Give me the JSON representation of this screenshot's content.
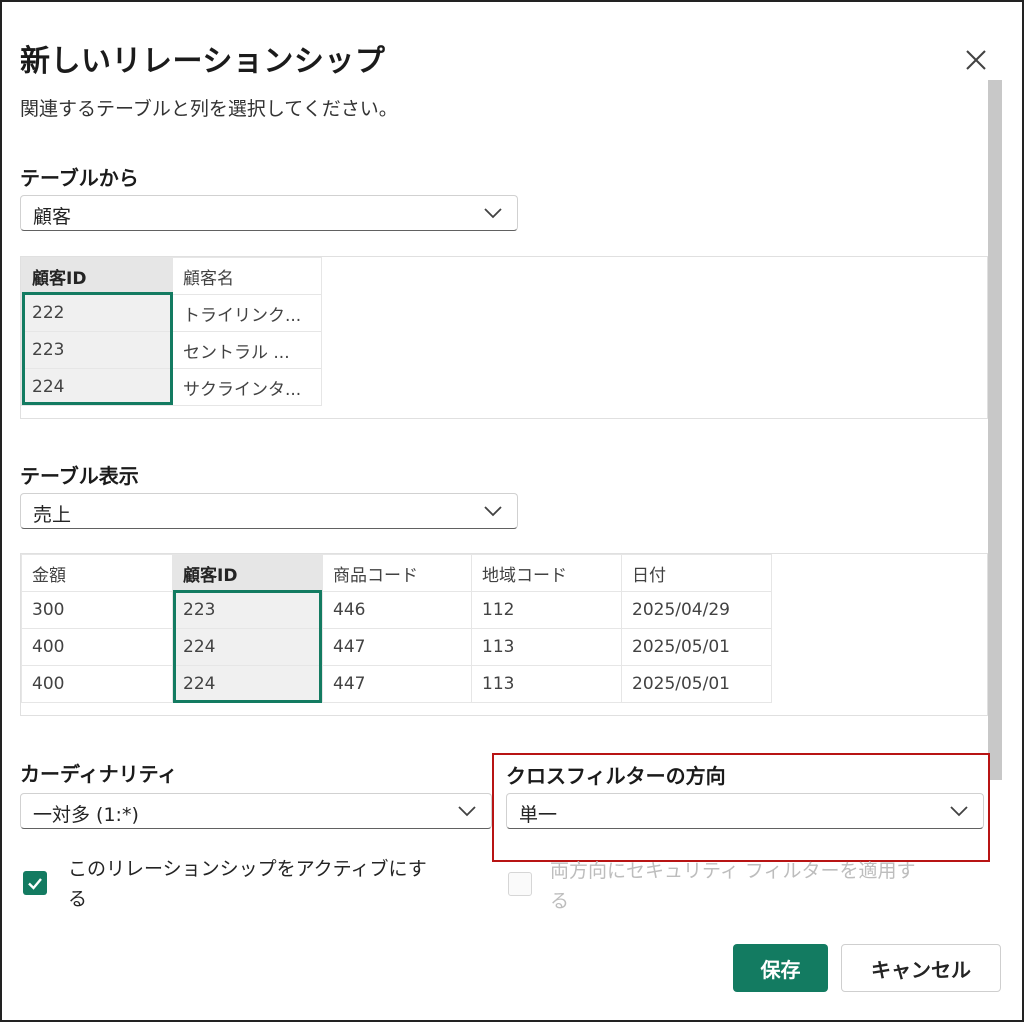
{
  "dialog": {
    "title": "新しいリレーションシップ",
    "subtitle": "関連するテーブルと列を選択してください。"
  },
  "from_table": {
    "label": "テーブルから",
    "selected": "顧客",
    "columns": [
      "顧客ID",
      "顧客名"
    ],
    "rows": [
      [
        "222",
        "トライリンク..."
      ],
      [
        "223",
        "セントラル ..."
      ],
      [
        "224",
        "サクラインタ..."
      ]
    ]
  },
  "to_table": {
    "label": "テーブル表示",
    "selected": "売上",
    "columns": [
      "金額",
      "顧客ID",
      "商品コード",
      "地域コード",
      "日付"
    ],
    "rows": [
      [
        "300",
        "223",
        "446",
        "112",
        "2025/04/29"
      ],
      [
        "400",
        "224",
        "447",
        "113",
        "2025/05/01"
      ],
      [
        "400",
        "224",
        "447",
        "113",
        "2025/05/01"
      ]
    ]
  },
  "cardinality": {
    "label": "カーディナリティ",
    "selected": "一対多 (1:*)"
  },
  "cross_filter": {
    "label": "クロスフィルターの方向",
    "selected": "単一"
  },
  "checkboxes": {
    "active_line1": "このリレーションシップをアクティブにす",
    "active_line2": "る",
    "security_line1": "両方向にセキュリティ フィルターを適用す",
    "security_line2": "る"
  },
  "buttons": {
    "save": "保存",
    "cancel": "キャンセル"
  },
  "colors": {
    "accent": "#137b61",
    "highlight_box": "#b81414"
  }
}
